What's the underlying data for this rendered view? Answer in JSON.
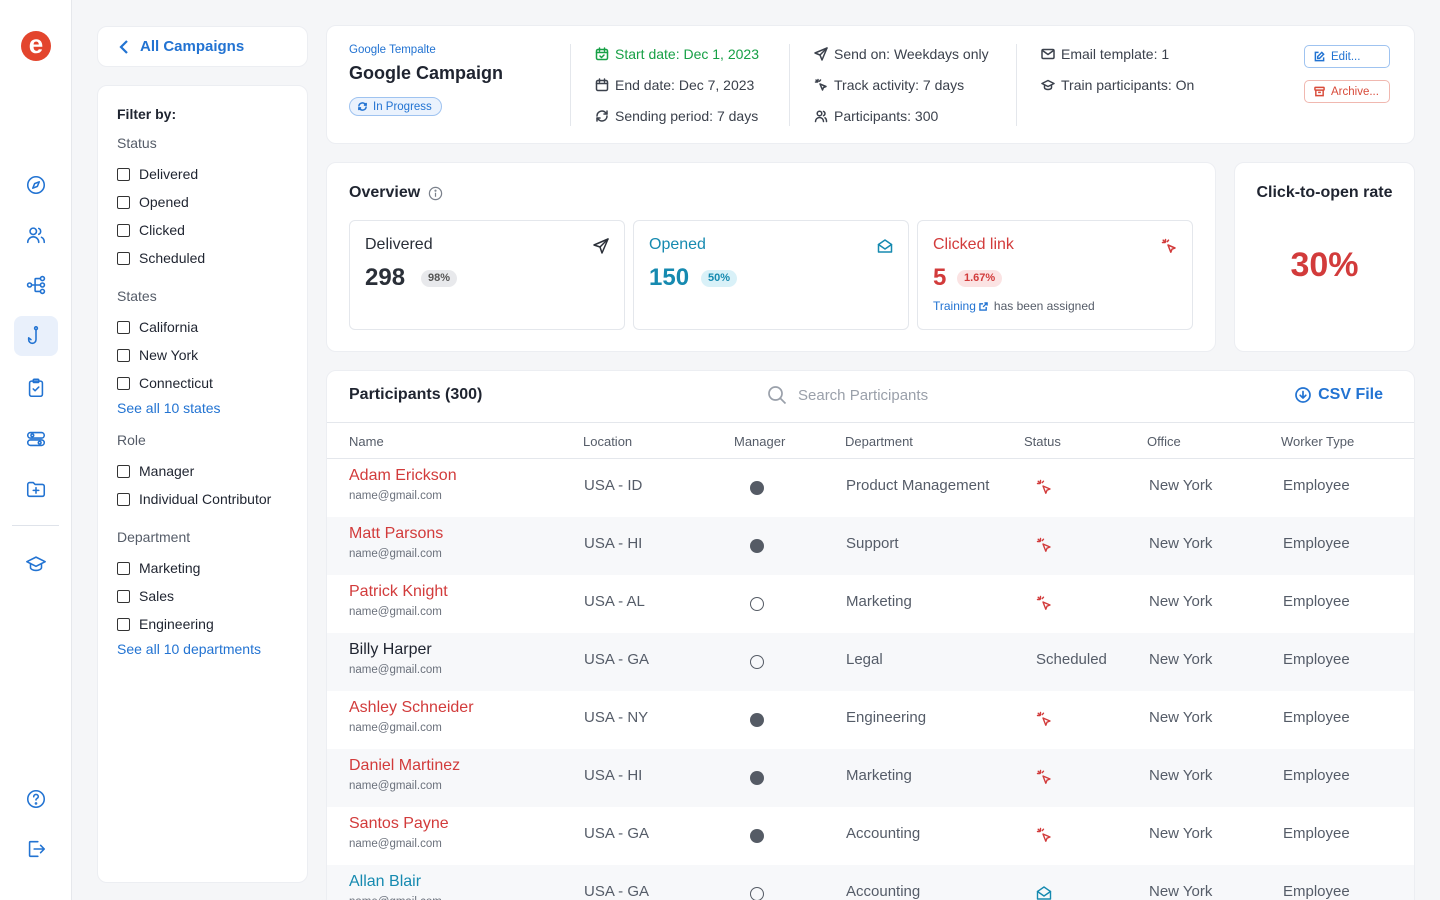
{
  "brand": {
    "logo_letter": "e",
    "accent": "#2273d2",
    "logo_color": "#e3452d"
  },
  "rail": {
    "items": [
      {
        "icon": "compass-icon"
      },
      {
        "icon": "users-icon"
      },
      {
        "icon": "workflow-icon"
      },
      {
        "icon": "phishing-hook-icon",
        "active": true
      },
      {
        "icon": "clipboard-check-icon"
      },
      {
        "icon": "toggles-icon"
      },
      {
        "icon": "folder-add-icon"
      },
      {
        "icon": "graduation-cap-icon"
      },
      {
        "icon": "help-icon"
      },
      {
        "icon": "logout-icon"
      }
    ]
  },
  "back": {
    "label": "All Campaigns"
  },
  "filters": {
    "title": "Filter by:",
    "status": {
      "title": "Status",
      "options": [
        "Delivered",
        "Opened",
        "Clicked",
        "Scheduled"
      ]
    },
    "states": {
      "title": "States",
      "options": [
        "California",
        "New York",
        "Connecticut"
      ],
      "see_all": "See all 10 states"
    },
    "role": {
      "title": "Role",
      "options": [
        "Manager",
        "Individual Contributor"
      ]
    },
    "department": {
      "title": "Department",
      "options": [
        "Marketing",
        "Sales",
        "Engineering"
      ],
      "see_all": "See all 10 departments"
    }
  },
  "campaign": {
    "template": "Google Tempalte",
    "name": "Google Campaign",
    "status": "In Progress",
    "start_date": "Start date: Dec 1, 2023",
    "end_date": "End date: Dec 7, 2023",
    "sending_period": "Sending period: 7 days",
    "send_on": "Send on: Weekdays only",
    "track_activity": "Track activity: 7 days",
    "participants": "Participants: 300",
    "email_template": "Email template: 1",
    "train_participants": "Train participants: On",
    "edit_label": "Edit...",
    "archive_label": "Archive..."
  },
  "overview": {
    "title": "Overview",
    "delivered": {
      "label": "Delivered",
      "value": "298",
      "pct": "98%"
    },
    "opened": {
      "label": "Opened",
      "value": "150",
      "pct": "50%"
    },
    "clicked": {
      "label": "Clicked link",
      "value": "5",
      "pct": "1.67%",
      "training_link": "Training",
      "note": "has been assigned"
    }
  },
  "ctor": {
    "title": "Click-to-open rate",
    "value": "30%"
  },
  "participants": {
    "title": "Participants (300)",
    "search_placeholder": "Search Participants",
    "csv_label": "CSV File",
    "columns": {
      "name": "Name",
      "location": "Location",
      "manager": "Manager",
      "department": "Department",
      "status": "Status",
      "office": "Office",
      "worker_type": "Worker Type"
    },
    "rows": [
      {
        "name": "Adam Erickson",
        "email": "name@gmail.com",
        "location": "USA - ID",
        "manager": true,
        "department": "Product Management",
        "status": "clicked",
        "office": "New York",
        "worker_type": "Employee"
      },
      {
        "name": "Matt Parsons",
        "email": "name@gmail.com",
        "location": "USA - HI",
        "manager": true,
        "department": "Support",
        "status": "clicked",
        "office": "New York",
        "worker_type": "Employee"
      },
      {
        "name": "Patrick Knight",
        "email": "name@gmail.com",
        "location": "USA - AL",
        "manager": false,
        "department": "Marketing",
        "status": "clicked",
        "office": "New York",
        "worker_type": "Employee"
      },
      {
        "name": "Billy Harper",
        "email": "name@gmail.com",
        "location": "USA - GA",
        "manager": false,
        "department": "Legal",
        "status": "Scheduled",
        "office": "New York",
        "worker_type": "Employee"
      },
      {
        "name": "Ashley Schneider",
        "email": "name@gmail.com",
        "location": "USA - NY",
        "manager": true,
        "department": "Engineering",
        "status": "clicked",
        "office": "New York",
        "worker_type": "Employee"
      },
      {
        "name": "Daniel Martinez",
        "email": "name@gmail.com",
        "location": "USA - HI",
        "manager": true,
        "department": "Marketing",
        "status": "clicked",
        "office": "New York",
        "worker_type": "Employee"
      },
      {
        "name": "Santos Payne",
        "email": "name@gmail.com",
        "location": "USA - GA",
        "manager": true,
        "department": "Accounting",
        "status": "clicked",
        "office": "New York",
        "worker_type": "Employee"
      },
      {
        "name": "Allan Blair",
        "email": "name@gmail.com",
        "location": "USA - GA",
        "manager": false,
        "department": "Accounting",
        "status": "opened",
        "office": "New York",
        "worker_type": "Employee"
      }
    ]
  }
}
